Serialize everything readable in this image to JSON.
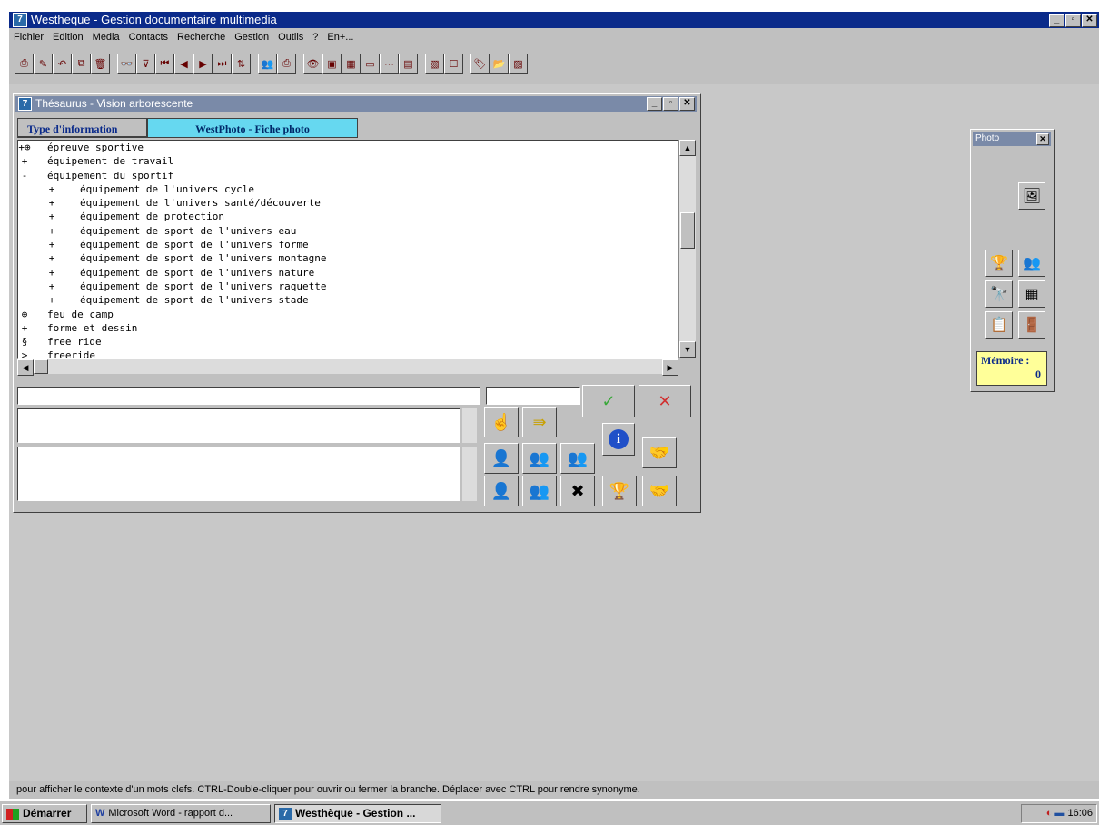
{
  "app": {
    "title": "Westheque - Gestion documentaire multimedia",
    "icon_text": "7"
  },
  "menu": [
    "Fichier",
    "Edition",
    "Media",
    "Contacts",
    "Recherche",
    "Gestion",
    "Outils",
    "?",
    "En+..."
  ],
  "toolbar_icons": [
    "print-icon",
    "edit-icon",
    "undo-icon",
    "copy-icon",
    "trash-icon",
    "binoculars-icon",
    "filter-icon",
    "first-icon",
    "prev-icon",
    "next-icon",
    "last-icon",
    "sort-icon",
    "users-icon",
    "printer-icon",
    "eye-icon",
    "image-icon",
    "grid-icon",
    "window-icon",
    "dots-icon",
    "document-icon",
    "layout-icon",
    "checkbox-icon",
    "tag-icon",
    "folder-help-icon",
    "photo-icon"
  ],
  "thesaurus": {
    "title": "Thésaurus - Vision arborescente",
    "tabs": [
      "Type d'information",
      "WestPhoto - Fiche photo"
    ],
    "tree": [
      {
        "mark": "+⊕",
        "label": "épreuve sportive",
        "level": 0
      },
      {
        "mark": "+",
        "label": "équipement de travail",
        "level": 0
      },
      {
        "mark": "-",
        "label": "équipement du sportif",
        "level": 0
      },
      {
        "mark": "+",
        "label": "équipement de l'univers cycle",
        "level": 1
      },
      {
        "mark": "+",
        "label": "équipement de l'univers santé/découverte",
        "level": 1
      },
      {
        "mark": "+",
        "label": "équipement de protection",
        "level": 1
      },
      {
        "mark": "+",
        "label": "équipement de sport de l'univers eau",
        "level": 1
      },
      {
        "mark": "+",
        "label": "équipement de sport de l'univers forme",
        "level": 1
      },
      {
        "mark": "+",
        "label": "équipement de sport de l'univers montagne",
        "level": 1
      },
      {
        "mark": "+",
        "label": "équipement de sport de l'univers nature",
        "level": 1
      },
      {
        "mark": "+",
        "label": "équipement de sport de l'univers raquette",
        "level": 1
      },
      {
        "mark": "+",
        "label": "équipement de sport de l'univers stade",
        "level": 1
      },
      {
        "mark": "⊕",
        "label": "feu de camp",
        "level": 0
      },
      {
        "mark": "+",
        "label": "forme et dessin",
        "level": 0
      },
      {
        "mark": "§",
        "label": "free ride",
        "level": 0
      },
      {
        "mark": ">",
        "label": "freeride",
        "level": 0
      }
    ],
    "ok_glyph": "✓",
    "cancel_glyph": "✕",
    "info_glyph": "i"
  },
  "palette": {
    "title": "Photo",
    "memory_label": "Mémoire :",
    "memory_value": "0"
  },
  "status_text": "pour afficher le contexte d'un mots clefs. CTRL-Double-cliquer pour ouvrir ou fermer la branche. Déplacer avec CTRL pour rendre synonyme.",
  "taskbar": {
    "start": "Démarrer",
    "tasks": [
      "Microsoft Word - rapport d...",
      "Westhèque - Gestion ..."
    ],
    "clock": "16:06"
  },
  "colors": {
    "title_active": "#0a2a8a",
    "title_inactive": "#7a8aa8",
    "tab_highlight": "#66d8f0",
    "memory_bg": "#ffff99"
  }
}
